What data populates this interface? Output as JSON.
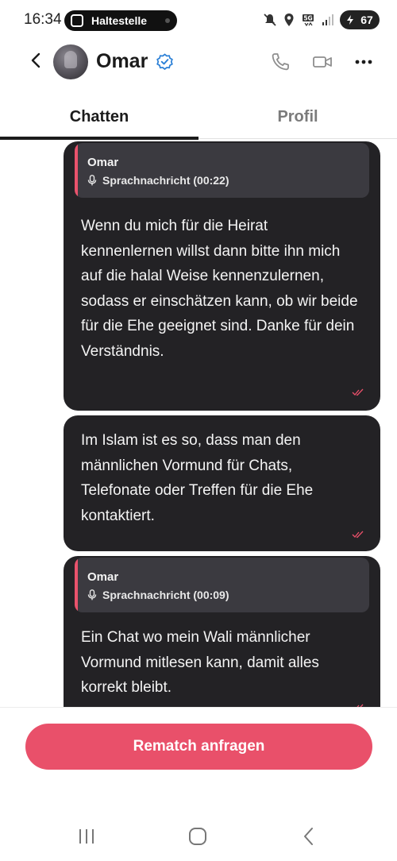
{
  "status_bar": {
    "time": "16:34",
    "notification_pill": "Haltestelle",
    "battery": "67",
    "network": "5G"
  },
  "header": {
    "contact_name": "Omar",
    "verified": true
  },
  "tabs": [
    {
      "label": "Chatten",
      "active": true
    },
    {
      "label": "Profil",
      "active": false
    }
  ],
  "messages": [
    {
      "quote": {
        "name": "Omar",
        "text": "Sprachnachricht (00:22)"
      },
      "text": "Wenn du mich für die Heirat kennenlernen willst dann bitte ihn mich auf die halal Weise kennenzulernen, sodass er einschätzen kann, ob wir beide für die Ehe geeignet sind. Danke für dein Verständnis."
    },
    {
      "text": "Im Islam ist es so, dass man den männlichen Vormund für Chats, Telefonate oder Treffen für die Ehe kontaktiert."
    },
    {
      "quote": {
        "name": "Omar",
        "text": "Sprachnachricht (00:09)"
      },
      "text": "Ein Chat wo mein Wali männlicher Vormund mitlesen kann, damit alles korrekt bleibt."
    }
  ],
  "action_button": {
    "label": "Rematch anfragen"
  },
  "colors": {
    "accent": "#e9506a",
    "bubble": "#232225",
    "quote_bg": "#3b3a40"
  }
}
